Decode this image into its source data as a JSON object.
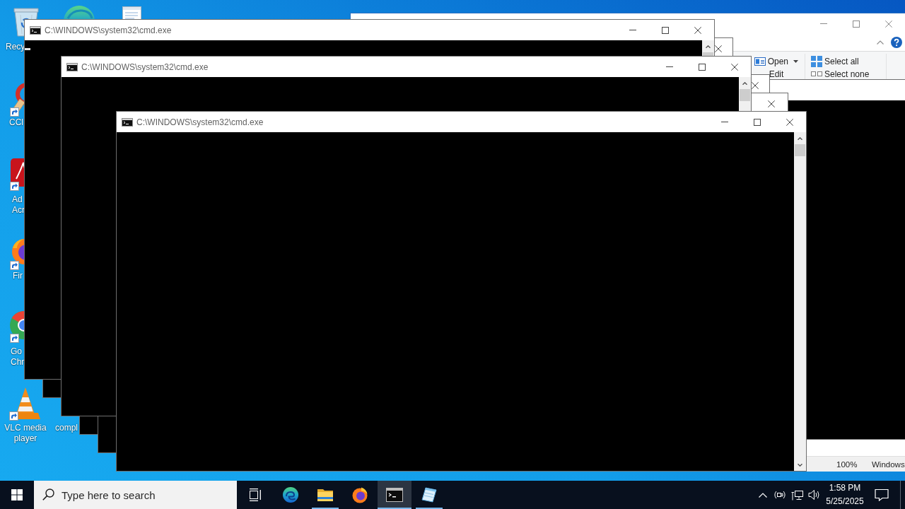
{
  "desktop": {
    "icons": [
      {
        "kind": "recycle-bin",
        "shortcut": false,
        "label_lines": [
          "Recy"
        ]
      },
      {
        "kind": "edge"
      },
      {
        "kind": "document"
      },
      {
        "kind": "ccleaner",
        "shortcut": true,
        "label_lines": [
          "CCl"
        ]
      },
      {
        "kind": "acrobat",
        "shortcut": true,
        "label_lines": [
          "Ad",
          "Acr"
        ]
      },
      {
        "kind": "firefox",
        "shortcut": true,
        "label_lines": [
          "Fir"
        ]
      },
      {
        "kind": "chrome",
        "shortcut": true,
        "label_lines": [
          "Go",
          "Chr"
        ]
      },
      {
        "kind": "vlc",
        "shortcut": true,
        "label_lines": [
          "VLC media",
          "player"
        ]
      },
      {
        "label_lines": [
          "compl"
        ]
      }
    ]
  },
  "explorer_window": {
    "ribbon_groups": [
      {
        "items": [
          {
            "kind": "open",
            "label": "Open",
            "dropdown": true
          },
          {
            "label": "Edit",
            "dropdown": false
          }
        ]
      },
      {
        "items": [
          {
            "kind": "select-all",
            "label": "Select all",
            "dropdown": false
          },
          {
            "kind": "select-none",
            "label": "Select none",
            "dropdown": false
          }
        ]
      }
    ]
  },
  "status_window": {
    "status_items": [
      "100%",
      "Windows"
    ]
  },
  "console_windows": [
    {
      "kind": "console"
    },
    {
      "kind": "console"
    },
    {
      "kind": "console"
    },
    {
      "kind": "console"
    },
    {
      "kind": "console",
      "title": "C:\\WINDOWS\\system32\\cmd.exe",
      "cursor": true
    },
    {
      "kind": "console",
      "title": "C:\\WINDOWS\\system32\\cmd.exe",
      "cursor": false
    },
    {
      "kind": "console",
      "title": "C:\\WINDOWS\\system32\\cmd.exe",
      "cursor": false
    }
  ],
  "taskbar": {
    "search": {
      "placeholder": "Type here to search"
    },
    "apps": [
      {
        "kind": "edge",
        "running": false,
        "selected": false
      },
      {
        "kind": "file-explorer",
        "running": true,
        "selected": false
      },
      {
        "kind": "firefox",
        "running": false,
        "selected": false
      },
      {
        "kind": "console",
        "running": true,
        "selected": true
      },
      {
        "kind": "notepad",
        "running": true,
        "selected": false
      }
    ],
    "clock": {
      "time": "1:58 PM",
      "date": "5/25/2025"
    }
  }
}
